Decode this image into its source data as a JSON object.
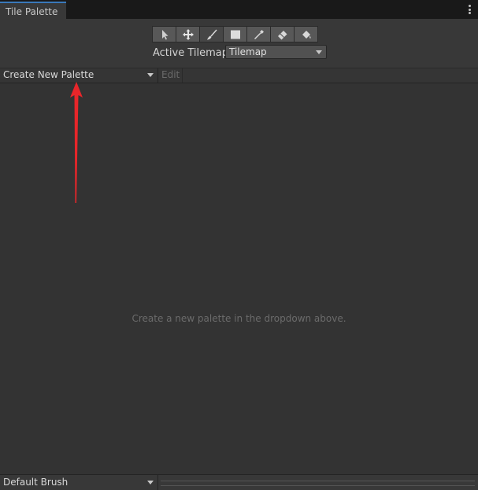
{
  "window": {
    "tab_title": "Tile Palette"
  },
  "toolbar": {
    "tools": [
      {
        "name": "select",
        "icon": "select-arrow-icon"
      },
      {
        "name": "move",
        "icon": "move-icon"
      },
      {
        "name": "paint",
        "icon": "paintbrush-icon",
        "active": true
      },
      {
        "name": "box-fill",
        "icon": "box-fill-icon"
      },
      {
        "name": "pick",
        "icon": "eyedropper-icon"
      },
      {
        "name": "erase",
        "icon": "eraser-icon"
      },
      {
        "name": "fill",
        "icon": "bucket-fill-icon"
      }
    ]
  },
  "active_tilemap": {
    "label": "Active Tilemap",
    "value": "Tilemap"
  },
  "palette": {
    "dropdown_value": "Create New Palette",
    "edit_label": "Edit",
    "empty_message": "Create a new palette in the dropdown above."
  },
  "brush": {
    "dropdown_value": "Default Brush"
  },
  "colors": {
    "accent_tab": "#3a79bb",
    "annotation_arrow": "#e8262a"
  }
}
